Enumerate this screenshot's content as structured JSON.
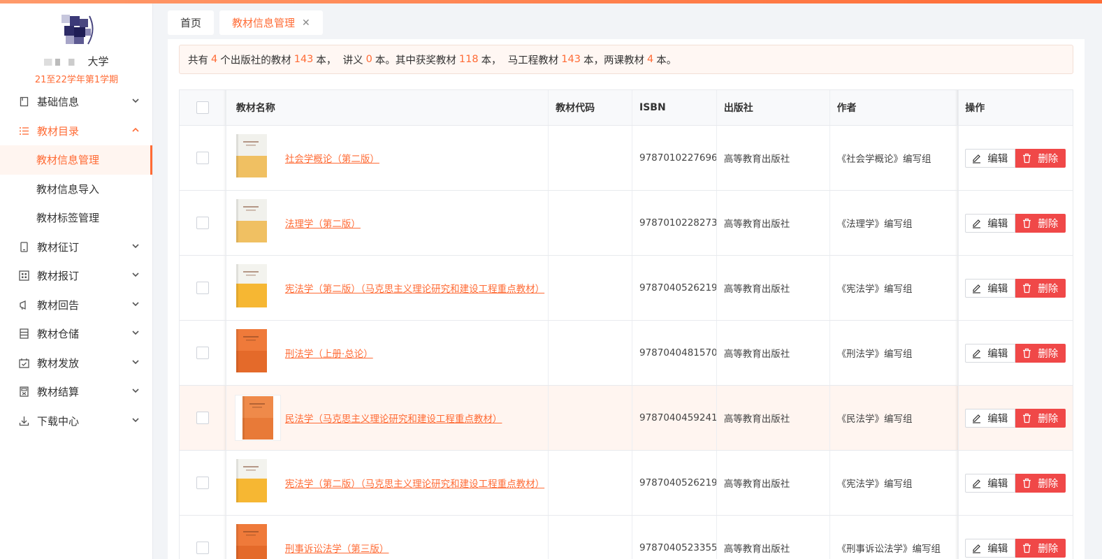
{
  "sidebar": {
    "university_suffix": "大学",
    "term": "21至22学年第1学期",
    "menu": [
      {
        "label": "基础信息",
        "icon": "book-icon"
      },
      {
        "label": "教材目录",
        "icon": "list-icon",
        "expanded": true,
        "children": [
          {
            "label": "教材信息管理",
            "current": true
          },
          {
            "label": "教材信息导入"
          },
          {
            "label": "教材标签管理"
          }
        ]
      },
      {
        "label": "教材征订",
        "icon": "tablet-icon"
      },
      {
        "label": "教材报订",
        "icon": "grid-icon"
      },
      {
        "label": "教材回告",
        "icon": "megaphone-icon"
      },
      {
        "label": "教材仓储",
        "icon": "warehouse-icon"
      },
      {
        "label": "教材发放",
        "icon": "calendar-icon"
      },
      {
        "label": "教材结算",
        "icon": "calculator-icon"
      },
      {
        "label": "下载中心",
        "icon": "download-icon"
      }
    ]
  },
  "tabs": [
    {
      "label": "首页",
      "active": false
    },
    {
      "label": "教材信息管理",
      "active": true,
      "closable": true
    }
  ],
  "summary": {
    "t1": "共有",
    "publishers": "4",
    "t2": "个出版社的教材",
    "books": "143",
    "t3": "本，  讲义",
    "handouts": "0",
    "t4": "本。其中获奖教材",
    "awarded": "118",
    "t5": "本，  马工程教材",
    "magongcheng": "143",
    "t6": "本，两课教材",
    "liangke": "4",
    "t7": "本。"
  },
  "table": {
    "headers": {
      "name": "教材名称",
      "code": "教材代码",
      "isbn": "ISBN",
      "publisher": "出版社",
      "author": "作者",
      "ops": "操作"
    },
    "edit_label": "编辑",
    "delete_label": "删除",
    "rows": [
      {
        "name": "社会学概论（第二版）",
        "code": "",
        "isbn": "9787010227696",
        "publisher": "高等教育出版社",
        "author": "《社会学概论》编写组",
        "cover": "yellow"
      },
      {
        "name": "法理学（第二版）",
        "code": "",
        "isbn": "9787010228273",
        "publisher": "高等教育出版社",
        "author": "《法理学》编写组",
        "cover": "yellow"
      },
      {
        "name": "宪法学（第二版）（马克思主义理论研究和建设工程重点教材）",
        "code": "",
        "isbn": "9787040526219",
        "publisher": "高等教育出版社",
        "author": "《宪法学》编写组",
        "cover": "gold"
      },
      {
        "name": "刑法学（上册·总论）",
        "code": "",
        "isbn": "9787040481570",
        "publisher": "高等教育出版社",
        "author": "《刑法学》编写组",
        "cover": "orange"
      },
      {
        "name": "民法学（马克思主义理论研究和建设工程重点教材）",
        "code": "",
        "isbn": "9787040459241",
        "publisher": "高等教育出版社",
        "author": "《民法学》编写组",
        "cover": "orange-framed"
      },
      {
        "name": "宪法学（第二版）（马克思主义理论研究和建设工程重点教材）",
        "code": "",
        "isbn": "9787040526219",
        "publisher": "高等教育出版社",
        "author": "《宪法学》编写组",
        "cover": "gold"
      },
      {
        "name": "刑事诉讼法学（第三版）",
        "code": "",
        "isbn": "9787040523355",
        "publisher": "高等教育出版社",
        "author": "《刑事诉讼法学》编写组",
        "cover": "orange"
      }
    ]
  },
  "colors": {
    "accent": "#ff6b35",
    "danger": "#f04848"
  }
}
